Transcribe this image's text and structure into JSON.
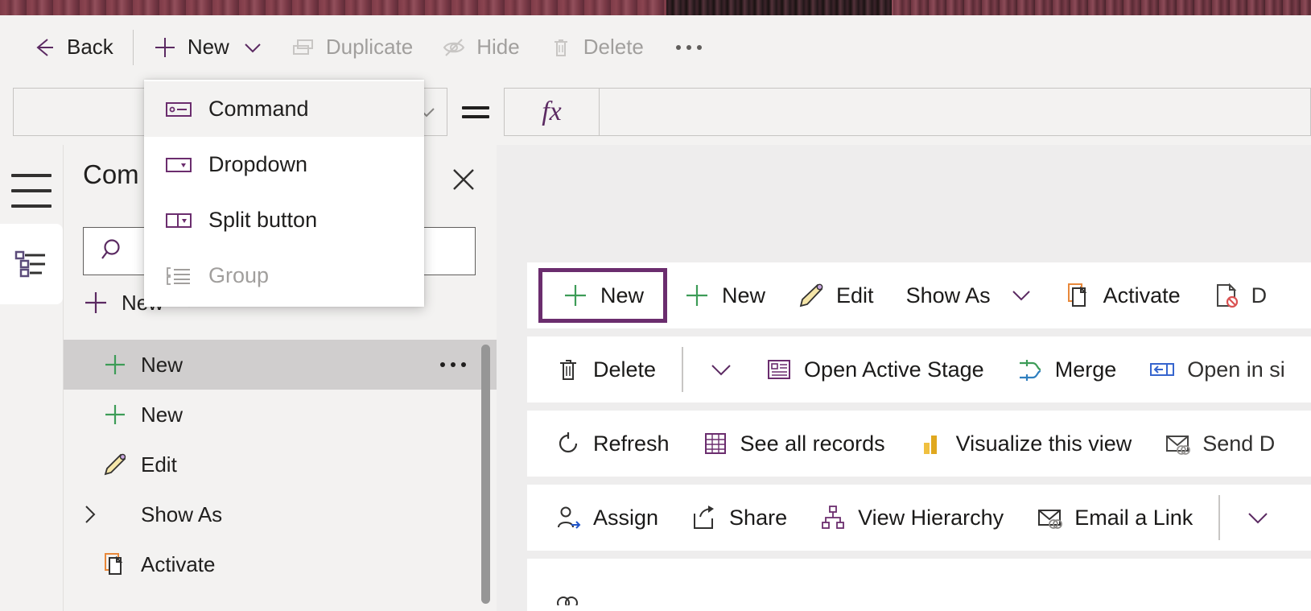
{
  "toolbar": {
    "items": [
      {
        "label": "Back",
        "icon": "arrow-left-icon",
        "disabled": false,
        "chevron": false
      },
      {
        "label": "New",
        "icon": "plus-icon",
        "disabled": false,
        "chevron": true
      },
      {
        "label": "Duplicate",
        "icon": "duplicate-icon",
        "disabled": true,
        "chevron": false
      },
      {
        "label": "Hide",
        "icon": "hide-eye-icon",
        "disabled": true,
        "chevron": false
      },
      {
        "label": "Delete",
        "icon": "trash-icon",
        "disabled": true,
        "chevron": false
      }
    ],
    "overflow_label": "..."
  },
  "property_bar": {
    "selected_property": "",
    "equals_sign": "=",
    "fx_label": "fx",
    "formula_value": ""
  },
  "flyout_menu": {
    "items": [
      {
        "label": "Command",
        "icon": "command-icon",
        "disabled": false,
        "hover": true
      },
      {
        "label": "Dropdown",
        "icon": "dropdown-icon",
        "disabled": false,
        "hover": false
      },
      {
        "label": "Split button",
        "icon": "split-button-icon",
        "disabled": false,
        "hover": false
      },
      {
        "label": "Group",
        "icon": "group-icon",
        "disabled": true,
        "hover": false
      }
    ]
  },
  "rail": {
    "hamburger": "hamburger-icon",
    "tree_view": "tree-view-icon"
  },
  "panel": {
    "title": "Com",
    "close_label": "✕",
    "search_placeholder": "",
    "search_value": "",
    "new_label": "New",
    "tree_items": [
      {
        "label": "New",
        "icon": "plus-icon",
        "selected": true,
        "expander": false,
        "overflow": true
      },
      {
        "label": "New",
        "icon": "plus-icon",
        "selected": false,
        "expander": false,
        "overflow": false
      },
      {
        "label": "Edit",
        "icon": "pencil-icon",
        "selected": false,
        "expander": false,
        "overflow": false
      },
      {
        "label": "Show As",
        "icon": "none",
        "selected": false,
        "expander": true,
        "overflow": false
      },
      {
        "label": "Activate",
        "icon": "page-icon",
        "selected": false,
        "expander": false,
        "overflow": false
      }
    ]
  },
  "canvas": {
    "rows": [
      {
        "buttons": [
          {
            "label": "New",
            "icon": "plus-icon",
            "selected": true,
            "chevron": false,
            "sep_before": false
          },
          {
            "label": "New",
            "icon": "plus-icon",
            "selected": false,
            "chevron": false,
            "sep_before": false
          },
          {
            "label": "Edit",
            "icon": "pencil-icon",
            "selected": false,
            "chevron": false,
            "sep_before": false
          },
          {
            "label": "Show As",
            "icon": "none",
            "selected": false,
            "chevron": true,
            "sep_before": false
          },
          {
            "label": "Activate",
            "icon": "page-icon",
            "selected": false,
            "chevron": false,
            "sep_before": false
          },
          {
            "label": "D",
            "icon": "deactivate-icon",
            "selected": false,
            "chevron": false,
            "sep_before": false
          }
        ]
      },
      {
        "buttons": [
          {
            "label": "Delete",
            "icon": "trash-icon",
            "selected": false,
            "chevron": false,
            "sep_before": false
          },
          {
            "label": "",
            "icon": "none",
            "selected": false,
            "chevron": true,
            "sep_before": true
          },
          {
            "label": "Open Active Stage",
            "icon": "stage-icon",
            "selected": false,
            "chevron": false,
            "sep_before": false
          },
          {
            "label": "Merge",
            "icon": "merge-icon",
            "selected": false,
            "chevron": false,
            "sep_before": false
          },
          {
            "label": "Open in si",
            "icon": "open-in-side-icon",
            "selected": false,
            "chevron": false,
            "sep_before": false
          }
        ]
      },
      {
        "buttons": [
          {
            "label": "Refresh",
            "icon": "refresh-icon",
            "selected": false,
            "chevron": false,
            "sep_before": false
          },
          {
            "label": "See all records",
            "icon": "table-icon",
            "selected": false,
            "chevron": false,
            "sep_before": false
          },
          {
            "label": "Visualize this view",
            "icon": "chart-icon",
            "selected": false,
            "chevron": false,
            "sep_before": false
          },
          {
            "label": "Send D",
            "icon": "mail-link-icon",
            "selected": false,
            "chevron": false,
            "sep_before": false
          }
        ]
      },
      {
        "buttons": [
          {
            "label": "Assign",
            "icon": "assign-person-icon",
            "selected": false,
            "chevron": false,
            "sep_before": false
          },
          {
            "label": "Share",
            "icon": "share-icon",
            "selected": false,
            "chevron": false,
            "sep_before": false
          },
          {
            "label": "View Hierarchy",
            "icon": "hierarchy-icon",
            "selected": false,
            "chevron": false,
            "sep_before": false
          },
          {
            "label": "Email a Link",
            "icon": "mail-link-icon",
            "selected": false,
            "chevron": false,
            "sep_before": false
          },
          {
            "label": "",
            "icon": "none",
            "selected": false,
            "chevron": true,
            "sep_before": true
          }
        ]
      }
    ]
  },
  "colors": {
    "accent_purple": "#6b2d6e",
    "plus_green": "#3d9c57",
    "panel_bg": "#f3f2f1",
    "canvas_bg": "#eeeded",
    "selected_row": "#d0cece",
    "banner": "#7a3945"
  }
}
